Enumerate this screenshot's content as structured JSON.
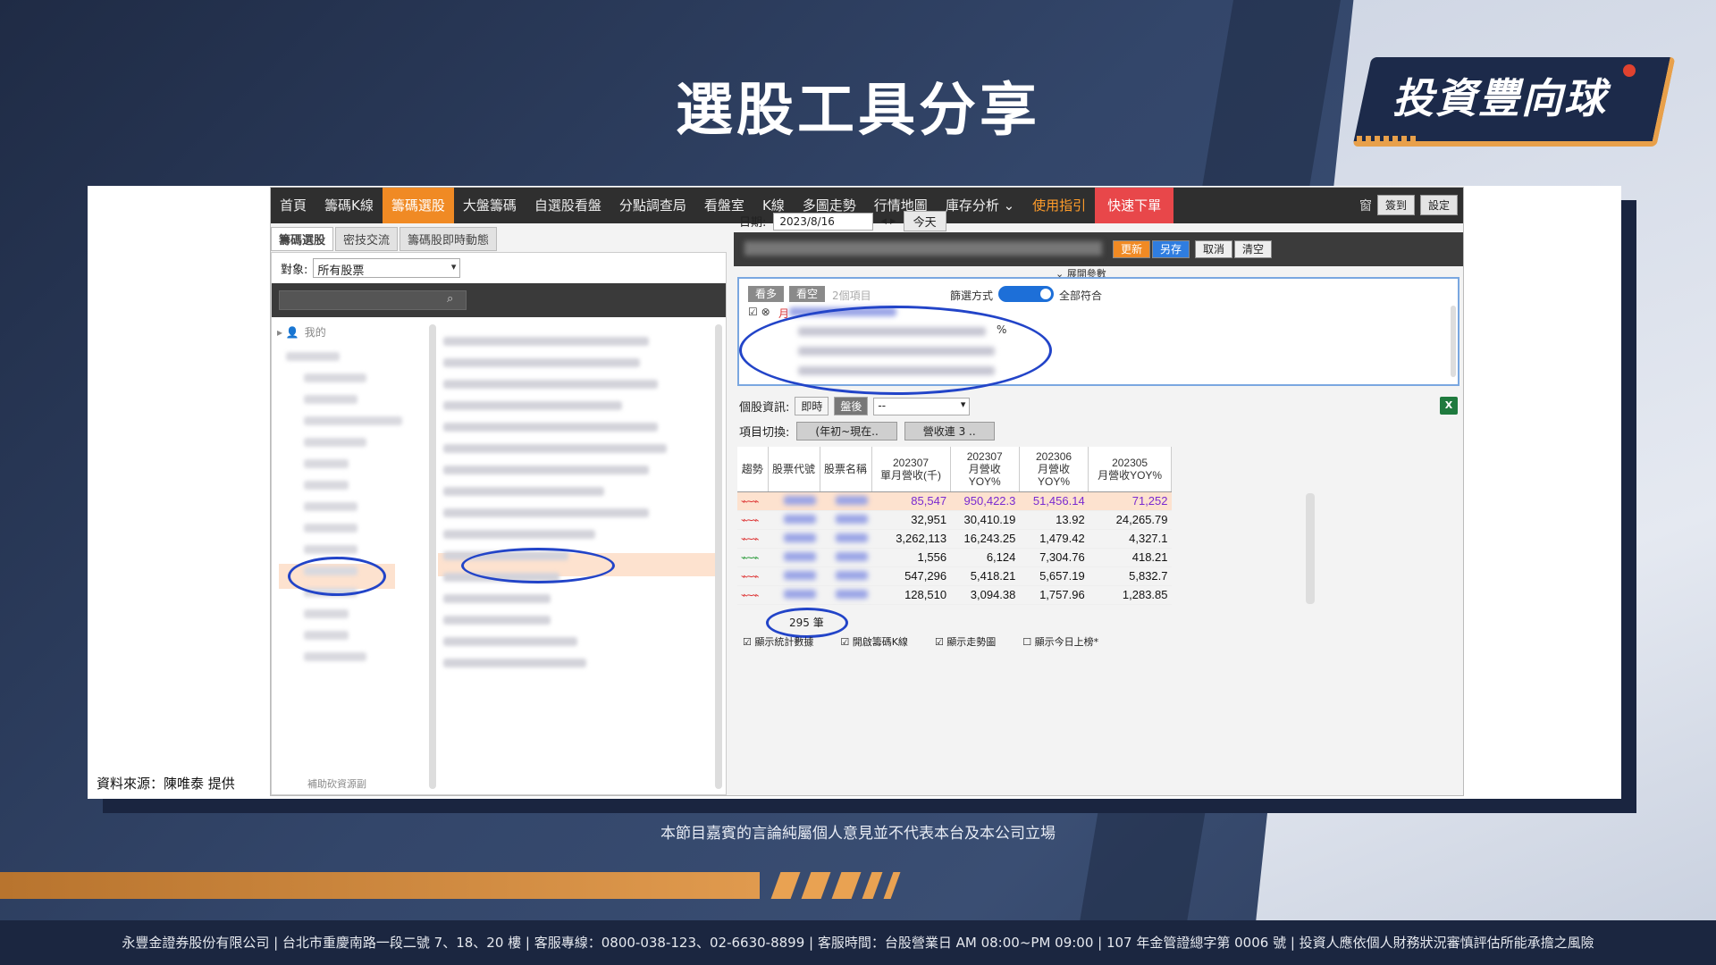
{
  "slide": {
    "title": "選股工具分享",
    "logo_text": "投資豐向球",
    "source_note": "資料來源：陳唯泰 提供",
    "disclaimer": "本節目嘉賓的言論純屬個人意見並不代表本台及本公司立場",
    "footer": "永豐金證券股份有限公司 | 台北市重慶南路一段二號 7、18、20 樓 | 客服專線：0800-038-123、02-6630-8899 | 客服時間：台股營業日 AM 08:00~PM 09:00 | 107 年金管證總字第 0006 號 | 投資人應依個人財務狀況審慎評估所能承擔之風險"
  },
  "nav": {
    "items": [
      "首頁",
      "籌碼K線",
      "籌碼選股",
      "大盤籌碼",
      "自選股看盤",
      "分點調查局",
      "看盤室",
      "K線",
      "多圖走勢",
      "行情地圖",
      "庫存分析 ⌄",
      "使用指引",
      "快速下單"
    ],
    "active_index": 2,
    "right_icon": "窗",
    "sign_in": "簽到",
    "settings": "設定"
  },
  "subtabs": [
    "籌碼選股",
    "密技交流",
    "籌碼股即時動態"
  ],
  "left": {
    "target_label": "對象:",
    "target_value": "所有股票",
    "tree_root": "我的",
    "bottom_label": "補助砍資源副"
  },
  "right": {
    "date_label": "日期:",
    "date_value": "2023/8/16",
    "today_btn": "今天",
    "update_btn": "更新",
    "save_as_btn": "另存",
    "cancel_btn": "取消",
    "clear_btn": "清空",
    "expand_label": "⌄ 展開參數",
    "chip_long": "看多",
    "chip_short": "看空",
    "item_count": "2個項目",
    "filter_mode_label": "篩選方式",
    "filter_mode_value": "全部符合",
    "percent_sign": "%",
    "cond_title": "月",
    "stock_info_label": "個股資訊:",
    "seg_realtime": "即時",
    "seg_after": "盤後",
    "info_select": "--",
    "switch_label": "項目切換:",
    "switch_left": "(年初~現在..",
    "switch_right": "營收連 3 ..",
    "excel_icon": "X"
  },
  "table": {
    "headers": [
      "趨勢",
      "股票代號",
      "股票名稱",
      "202307\n單月營收(千)",
      "202307\n月營收\nYOY%",
      "202306\n月營收\nYOY%",
      "202305\n月營收YOY%"
    ],
    "rows": [
      {
        "trend": "red",
        "c1": "85,547",
        "c2": "950,422.3",
        "c3": "51,456.14",
        "c4": "71,252"
      },
      {
        "trend": "red",
        "c1": "32,951",
        "c2": "30,410.19",
        "c3": "13.92",
        "c4": "24,265.79"
      },
      {
        "trend": "red",
        "c1": "3,262,113",
        "c2": "16,243.25",
        "c3": "1,479.42",
        "c4": "4,327.1"
      },
      {
        "trend": "green",
        "c1": "1,556",
        "c2": "6,124",
        "c3": "7,304.76",
        "c4": "418.21"
      },
      {
        "trend": "red",
        "c1": "547,296",
        "c2": "5,418.21",
        "c3": "5,657.19",
        "c4": "5,832.7"
      },
      {
        "trend": "red",
        "c1": "128,510",
        "c2": "3,094.38",
        "c3": "1,757.96",
        "c4": "1,283.85"
      }
    ],
    "count": "295 筆"
  },
  "footer_checks": [
    "顯示統計數據",
    "開啟籌碼K線",
    "顯示走勢圖",
    "顯示今日上榜*"
  ],
  "colors": {
    "accent": "#f08a24",
    "quick": "#e8474a",
    "annotation": "#2244c8"
  }
}
